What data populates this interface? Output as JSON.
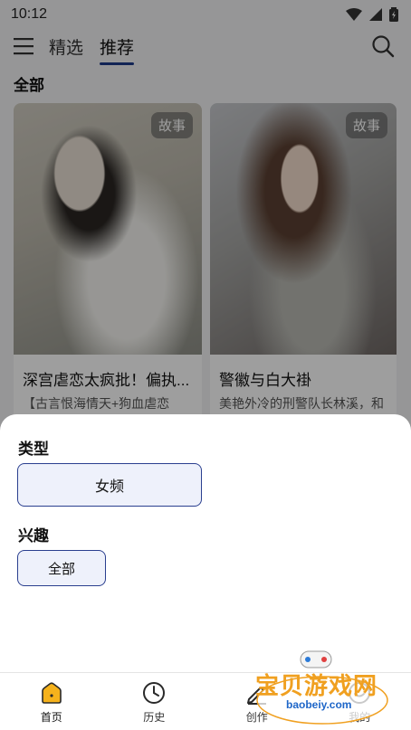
{
  "status_bar": {
    "time": "10:12"
  },
  "header": {
    "tabs": [
      {
        "label": "精选",
        "active": false
      },
      {
        "label": "推荐",
        "active": true
      }
    ]
  },
  "section": {
    "title": "全部"
  },
  "cards": [
    {
      "badge": "故事",
      "title": "深宫虐恋太疯批！偏执...",
      "desc": "【古言恨海情天+狗血虐恋"
    },
    {
      "badge": "故事",
      "title": "警徽与白大褂",
      "desc": "美艳外冷的刑警队长林溪，和"
    }
  ],
  "filter_sheet": {
    "type_label": "类型",
    "type_option": "女频",
    "interest_label": "兴趣",
    "interest_option": "全部"
  },
  "bottom_nav": {
    "items": [
      {
        "label": "首页",
        "icon": "home-icon",
        "active": true
      },
      {
        "label": "历史",
        "icon": "clock-icon",
        "active": false
      },
      {
        "label": "创作",
        "icon": "pen-icon",
        "active": false
      },
      {
        "label": "我的",
        "icon": "smile-icon",
        "active": false
      }
    ]
  },
  "watermark": {
    "text": "宝贝游戏网",
    "url": "baobeiy.com"
  },
  "colors": {
    "accent": "#1e3a8a",
    "home_icon": "#f5b21c",
    "option_bg": "#eef1fb"
  }
}
